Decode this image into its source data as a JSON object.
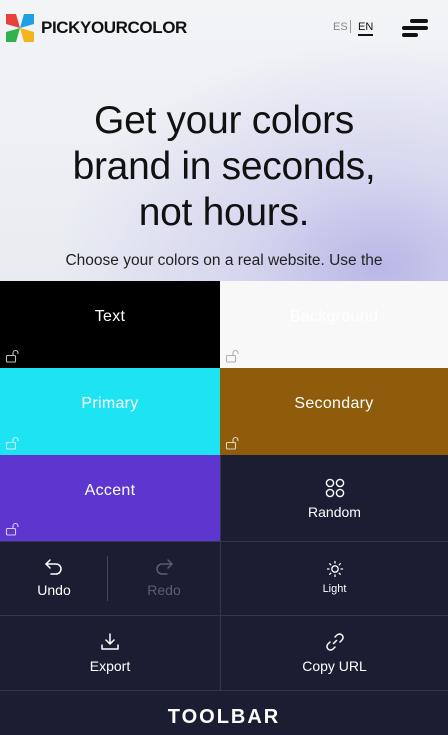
{
  "header": {
    "brand": "PICKYOURCOLOR",
    "lang_es": "ES",
    "lang_en": "EN"
  },
  "hero": {
    "headline_line1": "Get your colors",
    "headline_line2": "brand in seconds,",
    "headline_line3": "not hours.",
    "subtext": "Choose your colors on a real website. Use the"
  },
  "swatches": {
    "text": {
      "label": "Text",
      "color": "#000000",
      "text_color": "#ffffff"
    },
    "background": {
      "label": "Background",
      "color": "#f8f8f8",
      "text_color": "#ffffff"
    },
    "primary": {
      "label": "Primary",
      "color": "#1ee3f3",
      "text_color": "#ffffff"
    },
    "secondary": {
      "label": "Secondary",
      "color": "#8e5c0b",
      "text_color": "#ffffff"
    },
    "accent": {
      "label": "Accent",
      "color": "#5c36cf",
      "text_color": "#ffffff"
    }
  },
  "tools": {
    "random": "Random",
    "undo": "Undo",
    "redo": "Redo",
    "light": "Light",
    "export": "Export",
    "copy_url": "Copy URL"
  },
  "toolbar_label": "TOOLBAR",
  "colors": {
    "toolbar_bg": "#1b1e33",
    "disabled_text": "#5a5d73"
  }
}
